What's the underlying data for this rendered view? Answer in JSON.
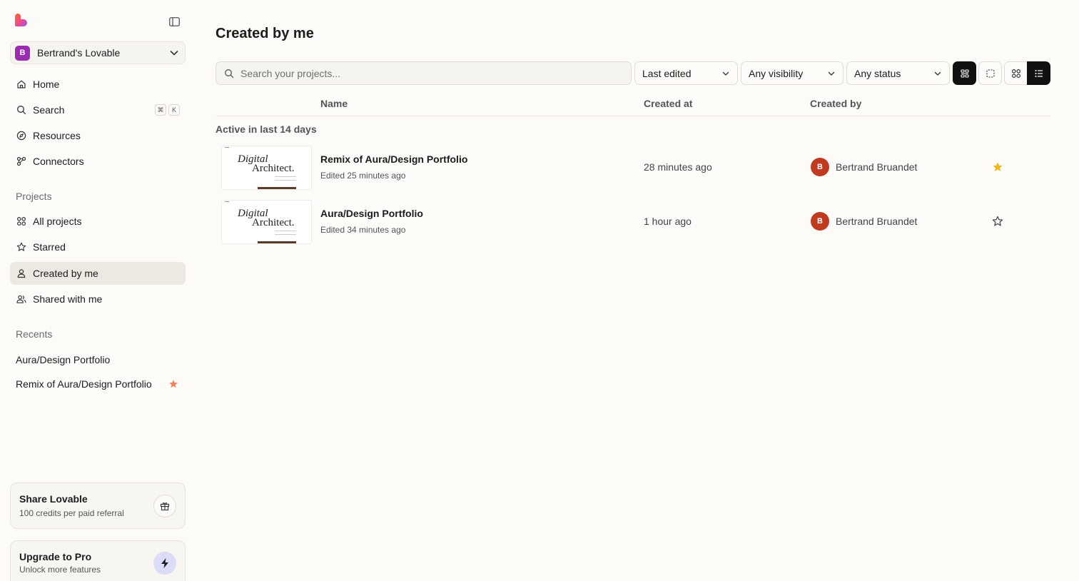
{
  "workspace": {
    "initial": "B",
    "name": "Bertrand's Lovable"
  },
  "nav": {
    "home": "Home",
    "search": "Search",
    "search_kbd_1": "⌘",
    "search_kbd_2": "K",
    "resources": "Resources",
    "connectors": "Connectors"
  },
  "projects_section": {
    "label": "Projects",
    "all": "All projects",
    "starred": "Starred",
    "created": "Created by me",
    "shared": "Shared with me"
  },
  "recents": {
    "label": "Recents",
    "items": [
      {
        "name": "Aura/Design Portfolio",
        "starred": false
      },
      {
        "name": "Remix of Aura/Design Portfolio",
        "starred": true
      }
    ]
  },
  "share_card": {
    "title": "Share Lovable",
    "subtitle": "100 credits per paid referral"
  },
  "upgrade_card": {
    "title": "Upgrade to Pro",
    "subtitle": "Unlock more features"
  },
  "main": {
    "title": "Created by me",
    "search_placeholder": "Search your projects...",
    "filters": {
      "sort": "Last edited",
      "visibility": "Any visibility",
      "status": "Any status"
    },
    "columns": {
      "name": "Name",
      "created_at": "Created at",
      "created_by": "Created by"
    },
    "group_label": "Active in last 14 days",
    "rows": [
      {
        "thumb_line1": "Digital",
        "thumb_line2": "Architect.",
        "title": "Remix of Aura/Design Portfolio",
        "subtitle": "Edited 25 minutes ago",
        "created_at": "28 minutes ago",
        "avatar": "B",
        "created_by": "Bertrand Bruandet",
        "starred": true
      },
      {
        "thumb_line1": "Digital",
        "thumb_line2": "Architect.",
        "title": "Aura/Design Portfolio",
        "subtitle": "Edited 34 minutes ago",
        "created_at": "1 hour ago",
        "avatar": "B",
        "created_by": "Bertrand Bruandet",
        "starred": false
      }
    ]
  },
  "colors": {
    "background": "#fcfbf8",
    "workspace_avatar": "#9b2bb0",
    "user_avatar": "#bf3a1f",
    "star_gold": "#f0b81c",
    "recent_star": "#f1825b",
    "upgrade_button": "#dcdcf6"
  }
}
